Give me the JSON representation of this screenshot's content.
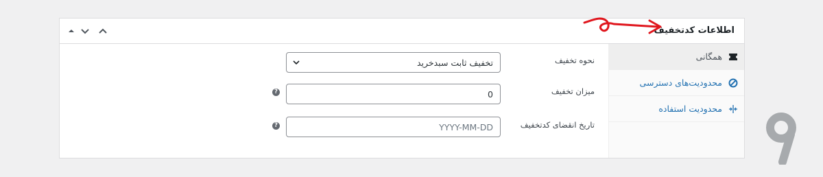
{
  "panel": {
    "title": "اطلاعات کدتخفیف",
    "header_controls": [
      "caret-up-small-icon",
      "chevron-down-icon",
      "chevron-up-icon"
    ]
  },
  "tabs": [
    {
      "label": "همگانی",
      "icon": "ticket-icon",
      "active": true
    },
    {
      "label": "محدودیت‌های دسترسی",
      "icon": "block-icon",
      "active": false
    },
    {
      "label": "محدودیت استفاده",
      "icon": "usage-arrows-icon",
      "active": false
    }
  ],
  "fields": {
    "discount_type": {
      "label": "نحوه تخفیف",
      "value": "تخفیف ثابت سبدخرید"
    },
    "amount": {
      "label": "میزان تخفیف",
      "value": "0",
      "help": "?"
    },
    "expiry": {
      "label": "تاریخ انقضای کدتخفیف",
      "placeholder": "YYYY-MM-DD",
      "help": "?"
    }
  },
  "colors": {
    "accent": "#2271b1",
    "annotation_arrow": "#e0161d",
    "logo": "#a7aaad"
  }
}
